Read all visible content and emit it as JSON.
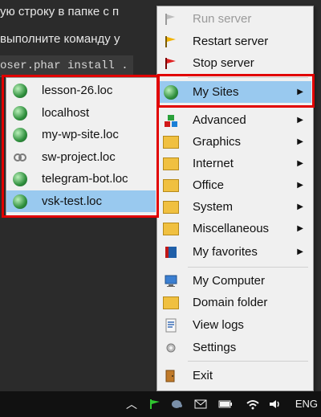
{
  "background": {
    "line1": "ую строку в папке с п",
    "line2": "выполните команду у",
    "code": "oser.phar install .",
    "right1": "",
    "right2": ""
  },
  "menu": {
    "items": [
      {
        "label": "Run server",
        "disabled": true,
        "arrow": false,
        "icon": "run-server-icon"
      },
      {
        "label": "Restart server",
        "disabled": false,
        "arrow": false,
        "icon": "restart-server-icon"
      },
      {
        "label": "Stop server",
        "disabled": false,
        "arrow": false,
        "icon": "stop-server-icon"
      },
      {
        "label": "My Sites",
        "disabled": false,
        "arrow": true,
        "icon": "globe-icon"
      },
      {
        "label": "Advanced",
        "disabled": false,
        "arrow": true,
        "icon": "advanced-icon"
      },
      {
        "label": "Graphics",
        "disabled": false,
        "arrow": true,
        "icon": "folder-icon"
      },
      {
        "label": "Internet",
        "disabled": false,
        "arrow": true,
        "icon": "folder-icon"
      },
      {
        "label": "Office",
        "disabled": false,
        "arrow": true,
        "icon": "folder-icon"
      },
      {
        "label": "System",
        "disabled": false,
        "arrow": true,
        "icon": "folder-icon"
      },
      {
        "label": "Miscellaneous",
        "disabled": false,
        "arrow": true,
        "icon": "folder-icon"
      },
      {
        "label": "My favorites",
        "disabled": false,
        "arrow": true,
        "icon": "book-icon"
      },
      {
        "label": "My Computer",
        "disabled": false,
        "arrow": false,
        "icon": "computer-icon"
      },
      {
        "label": "Domain folder",
        "disabled": false,
        "arrow": false,
        "icon": "folder-icon"
      },
      {
        "label": "View logs",
        "disabled": false,
        "arrow": false,
        "icon": "logs-icon"
      },
      {
        "label": "Settings",
        "disabled": false,
        "arrow": false,
        "icon": "gear-icon"
      },
      {
        "label": "Exit",
        "disabled": false,
        "arrow": false,
        "icon": "exit-icon"
      }
    ]
  },
  "submenu": {
    "items": [
      {
        "label": "lesson-26.loc",
        "icon": "globe-icon"
      },
      {
        "label": "localhost",
        "icon": "globe-icon"
      },
      {
        "label": "my-wp-site.loc",
        "icon": "globe-icon"
      },
      {
        "label": "sw-project.loc",
        "icon": "link-icon"
      },
      {
        "label": "telegram-bot.loc",
        "icon": "globe-icon"
      },
      {
        "label": "vsk-test.loc",
        "icon": "globe-icon"
      }
    ]
  },
  "taskbar": {
    "lang": "ENG",
    "tray_icons": [
      "chevron-up-icon",
      "flag-icon",
      "elephant-icon",
      "mail-icon",
      "battery-icon",
      "wifi-icon",
      "volume-icon"
    ]
  },
  "colors": {
    "highlight": "#99c9ef",
    "red": "#e10000"
  }
}
